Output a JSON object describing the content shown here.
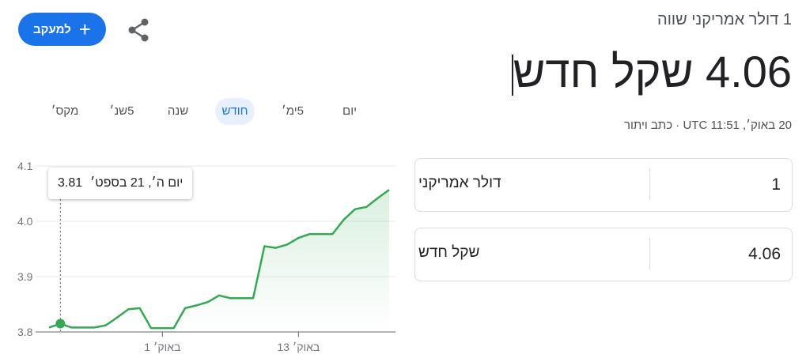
{
  "header": {
    "subtitle": "1 דולר אמריקני שווה",
    "rate": "4.06 שקל חדש",
    "timestamp": "20 באוק׳, UTC 11:51 · כתב ויתור"
  },
  "follow_button": {
    "label": "למעקב",
    "icon": "plus-icon"
  },
  "share_icon": "share-icon",
  "tabs": [
    {
      "label": "יום",
      "active": false
    },
    {
      "label": "5ימ׳",
      "active": false
    },
    {
      "label": "חודש",
      "active": true
    },
    {
      "label": "שנה",
      "active": false
    },
    {
      "label": "5שנ׳",
      "active": false
    },
    {
      "label": "מקס׳",
      "active": false
    }
  ],
  "converter": {
    "from": {
      "currency": "דולר אמריקני",
      "amount": "1"
    },
    "to": {
      "currency": "שקל חדש",
      "amount": "4.06"
    }
  },
  "tooltip": {
    "date": "יום ה׳, 21 בספט׳",
    "value": "3.81"
  },
  "colors": {
    "accent": "#1a73e8",
    "line": "#34a853"
  },
  "chart_data": {
    "type": "line",
    "ylim": [
      3.8,
      4.1
    ],
    "yticks": [
      "4.1",
      "4.0",
      "3.9",
      "3.8"
    ],
    "ytick_values": [
      4.1,
      4.0,
      3.9,
      3.8
    ],
    "xtick_labels": [
      "1 באוק׳",
      "13 באוק׳"
    ],
    "xtick_index": [
      10,
      22
    ],
    "highlight_index": 1,
    "series": [
      {
        "values": [
          3.808,
          3.815,
          3.808,
          3.808,
          3.808,
          3.812,
          3.826,
          3.841,
          3.843,
          3.807,
          3.807,
          3.807,
          3.843,
          3.848,
          3.854,
          3.866,
          3.861,
          3.861,
          3.861,
          3.955,
          3.952,
          3.958,
          3.97,
          3.977,
          3.977,
          3.977,
          4.003,
          4.022,
          4.026,
          4.042,
          4.057
        ]
      }
    ]
  }
}
